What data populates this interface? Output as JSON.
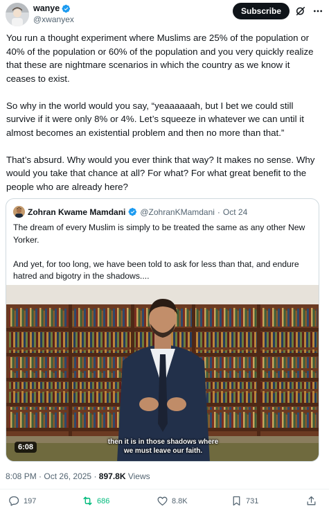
{
  "author": {
    "display_name": "wanye",
    "handle": "@xwanyex",
    "verified": true
  },
  "header": {
    "subscribe_label": "Subscribe",
    "icons": [
      "grok-icon",
      "more-icon"
    ]
  },
  "tweet": {
    "paragraphs": [
      "You run a thought experiment where Muslims are 25% of the population or 40% of the population or 60% of the population and you very quickly realize that these are nightmare scenarios in which the country as we know it ceases to exist.",
      "So why in the world would you say, “yeaaaaaah, but I bet we could still survive if it were only 8% or 4%. Let’s squeeze in whatever we can until it almost becomes an existential problem and then no more than that.”",
      "That’s absurd. Why would you ever think that way? It makes no sense. Why would you take that chance at all? For what? For what great benefit to the people who are already here?"
    ]
  },
  "quote": {
    "display_name": "Zohran Kwame Mamdani",
    "handle": "@ZohranKMamdani",
    "dot": "·",
    "date": "Oct 24",
    "verified": true,
    "paragraphs": [
      "The dream of every Muslim is simply to be treated the same as any other New Yorker.",
      "And yet, for too long, we have been told to ask for less than that, and endure hatred and bigotry in the shadows...."
    ],
    "video": {
      "duration": "6:08",
      "caption_line1": "then it is in those shadows where",
      "caption_line2": "we must leave our faith."
    }
  },
  "meta": {
    "time": "8:08 PM",
    "separator": "·",
    "date": "Oct 26, 2025",
    "views_count": "897.8K",
    "views_label": "Views"
  },
  "actions": {
    "replies": "197",
    "reposts": "686",
    "likes": "8.8K",
    "bookmarks": "731"
  },
  "colors": {
    "verified_blue": "#1d9bf0",
    "repost_green": "#00ba7c",
    "text_primary": "#0f1419",
    "text_secondary": "#536471",
    "border": "#cfd9de"
  }
}
